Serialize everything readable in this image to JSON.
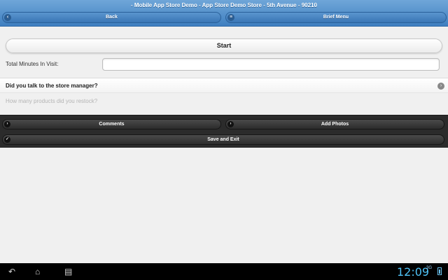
{
  "header": {
    "title": "- Mobile App Store Demo - App Store Demo Store - 5th Avenue - 90210",
    "back_label": "Back",
    "back_icon": "chevron-left-icon",
    "menu_label": "Brief Menu",
    "menu_icon": "menu-icon"
  },
  "form": {
    "start_label": "Start",
    "minutes_label": "Total Minutes In Visit:",
    "minutes_value": "",
    "collapsible_label": "Did you talk to the store manager?",
    "collapsible_icon": "chevron-right-icon",
    "restock_question": "How many products did you restock?"
  },
  "toolbar": {
    "comments_label": "Comments",
    "photos_label": "Add Photos",
    "save_label": "Save and Exit"
  },
  "system_bar": {
    "clock": "12:09",
    "signal": "3G"
  },
  "colors": {
    "header_blue": "#3f7fc0",
    "toolbar_dark": "#2b2b2b",
    "clock_blue": "#4fc3f7"
  }
}
